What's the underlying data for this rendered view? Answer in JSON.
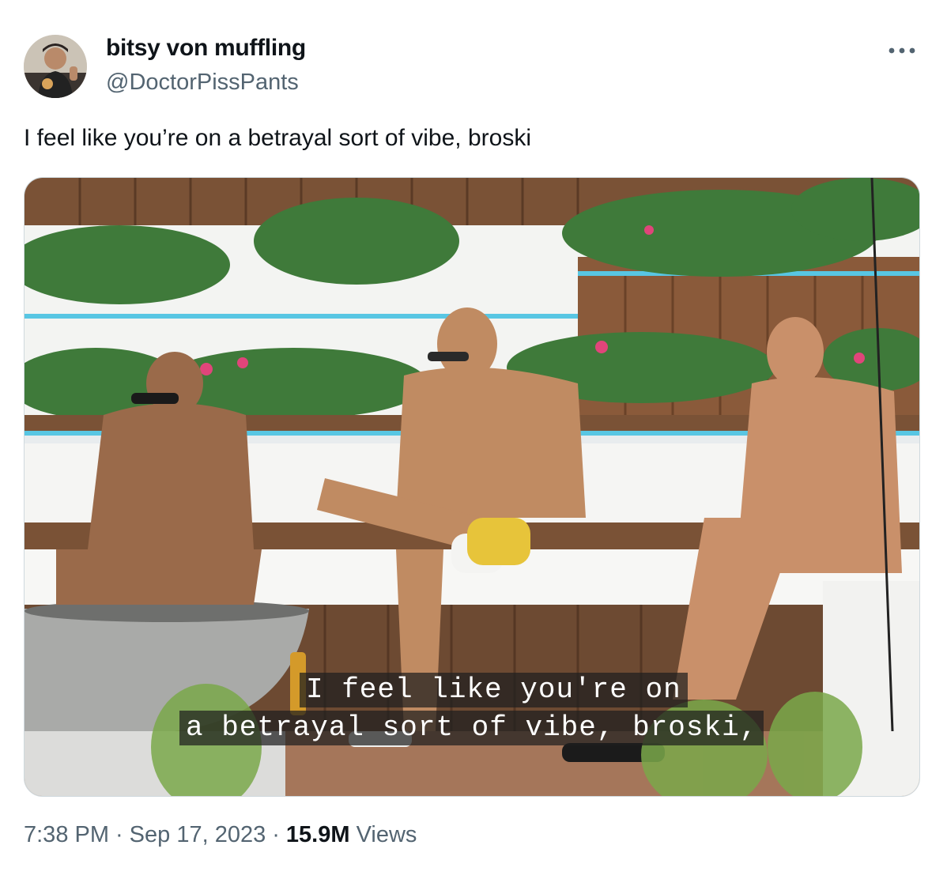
{
  "author": {
    "display_name": "bitsy von muffling",
    "handle": "@DoctorPissPants"
  },
  "tweet": {
    "text": "I feel like you’re on a betrayal sort of vibe, broski"
  },
  "media": {
    "subtitle_line1": "I feel like you're on",
    "subtitle_line2": "a betrayal sort of vibe, broski,"
  },
  "meta": {
    "time": "7:38 PM",
    "date": "Sep 17, 2023",
    "views_count": "15.9M",
    "views_label": "Views"
  },
  "icons": {
    "more": "more-horizontal-icon"
  }
}
